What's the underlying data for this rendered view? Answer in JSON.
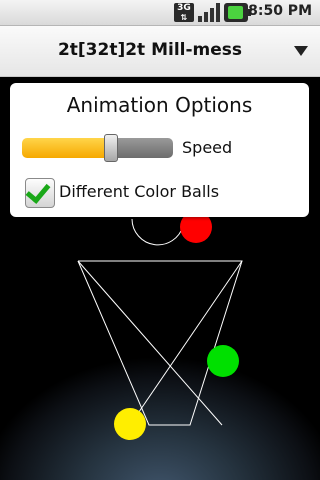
{
  "status_bar": {
    "network_label": "3G",
    "time": "8:50 PM"
  },
  "titlebar": {
    "title": "2t[32t]2t Mill-mess"
  },
  "options_panel": {
    "title": "Animation Options",
    "speed_label": "Speed",
    "speed_value": 0.6,
    "different_colors_label": "Different Color Balls",
    "different_colors_checked": true
  },
  "colors": {
    "ball_red": "#ff0000",
    "ball_green": "#00e000",
    "ball_yellow": "#ffee00",
    "accent_orange": "#f6a800"
  }
}
